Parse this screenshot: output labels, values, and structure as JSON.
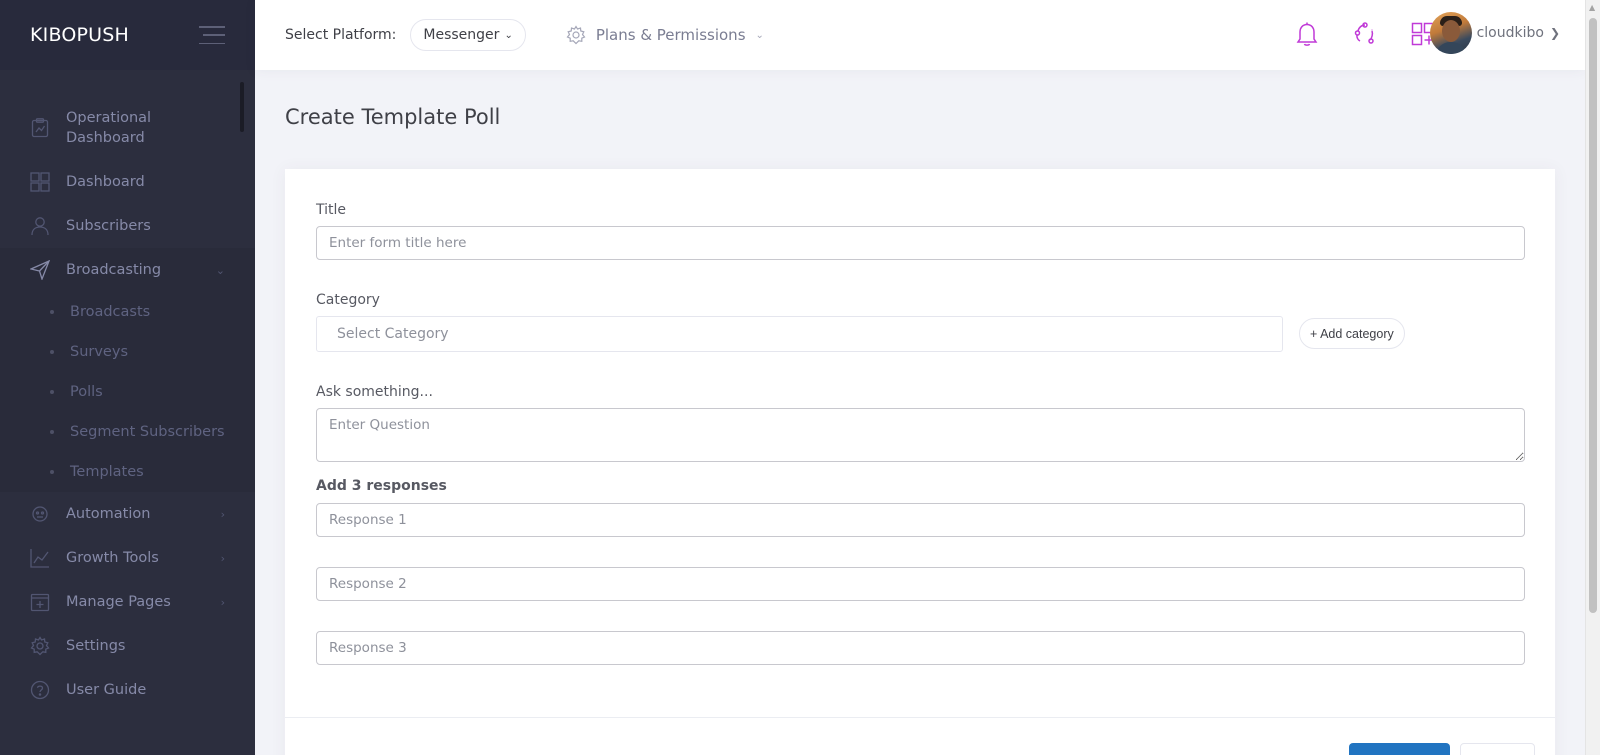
{
  "brand": {
    "name": "KIBOPUSH"
  },
  "sidebar": {
    "items": [
      {
        "label": "Operational Dashboard",
        "icon": "clipboard-chart-icon"
      },
      {
        "label": "Dashboard",
        "icon": "grid-icon"
      },
      {
        "label": "Subscribers",
        "icon": "user-icon"
      },
      {
        "label": "Broadcasting",
        "icon": "paper-plane-icon",
        "expanded": true,
        "children": [
          "Broadcasts",
          "Surveys",
          "Polls",
          "Segment Subscribers",
          "Templates"
        ]
      },
      {
        "label": "Automation",
        "icon": "robot-icon"
      },
      {
        "label": "Growth Tools",
        "icon": "line-chart-icon"
      },
      {
        "label": "Manage Pages",
        "icon": "add-page-icon"
      },
      {
        "label": "Settings",
        "icon": "gear-icon"
      },
      {
        "label": "User Guide",
        "icon": "question-circle-icon"
      }
    ]
  },
  "header": {
    "platform_label": "Select Platform:",
    "platform_value": "Messenger",
    "plans_label": "Plans & Permissions",
    "icons": [
      "bell-icon",
      "share-nodes-icon",
      "apps-grid-icon"
    ],
    "username": "cloudkibo",
    "accent_color": "#c03ad7"
  },
  "page": {
    "title": "Create Template Poll",
    "form": {
      "title_label": "Title",
      "title_placeholder": "Enter form title here",
      "category_label": "Category",
      "category_placeholder": "Select Category",
      "add_category": "+ Add category",
      "question_label": "Ask something...",
      "question_placeholder": "Enter Question",
      "responses_label": "Add 3 responses",
      "responses": [
        "Response 1",
        "Response 2",
        "Response 3"
      ]
    }
  }
}
